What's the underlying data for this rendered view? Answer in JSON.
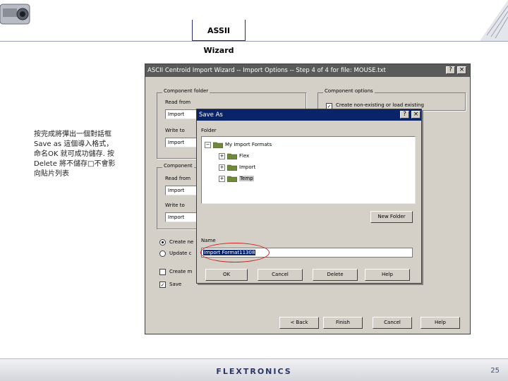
{
  "slide": {
    "header_title": "ASSII Wizard",
    "caption": "按完成將彈出一個對話框Save as 這個導入格式，命名OK 就可成功儲存. 按Delete 將不儲存□不會影向貼片列表",
    "footer_logo": "FLEXTRONICS",
    "page_number": "25"
  },
  "wizard": {
    "title": "ASCII Centroid Import Wizard -- Import Options -- Step 4 of 4 for file:  MOUSE.txt",
    "title_help": "?",
    "title_close": "×",
    "component_folder": {
      "label": "Component folder",
      "read_from_label": "Read from",
      "read_from_value": "Import",
      "write_to_label": "Write to",
      "write_to_value": "Import"
    },
    "component_options": {
      "label": "Component options",
      "create_option": "Create non-existing or load existing",
      "create_checked": "✓"
    },
    "component2": {
      "label": "Component",
      "read_from_label": "Read from",
      "read_from_value": "Import",
      "write_to_label": "Write to",
      "write_to_value": "Import"
    },
    "radio_create": "Create ne",
    "radio_update": "Update c",
    "check_create": "Create m",
    "check_save": "Save",
    "check_save_mark": "✓",
    "buttons": {
      "back": "< Back",
      "finish": "Finish",
      "cancel": "Cancel",
      "help": "Help"
    }
  },
  "saveas": {
    "title": "Save As",
    "title_help": "?",
    "title_close": "×",
    "folder_label": "Folder",
    "tree": {
      "root": "My Import Formats",
      "children": [
        "Flex",
        "Import",
        "Temp"
      ]
    },
    "new_folder": "New Folder",
    "name_label": "Name",
    "name_value": "Import Format11308",
    "buttons": {
      "ok": "OK",
      "cancel": "Cancel",
      "delete": "Delete",
      "help": "Help"
    }
  }
}
